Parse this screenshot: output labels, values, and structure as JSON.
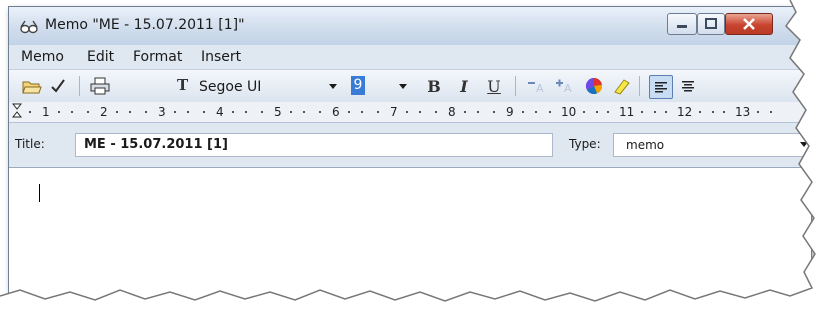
{
  "window": {
    "title": "Memo \"ME - 15.07.2011 [1]\"",
    "app_icon": "glasses-icon",
    "controls": {
      "minimize": "minimize-icon",
      "maximize": "maximize-icon",
      "close": "close-icon"
    }
  },
  "menubar": {
    "items": [
      {
        "label": "Memo"
      },
      {
        "label": "Edit"
      },
      {
        "label": "Format"
      },
      {
        "label": "Insert"
      }
    ]
  },
  "toolbar": {
    "open_icon": "open-folder-icon",
    "check_icon": "checkmark-icon",
    "print_icon": "printer-icon",
    "font_name": "Segoe UI",
    "font_size": "9",
    "bold_glyph": "B",
    "italic_glyph": "I",
    "underline_glyph": "U",
    "decrease_font_icon": "decrease-font-icon",
    "increase_font_icon": "increase-font-icon",
    "color_icon": "color-wheel-icon",
    "highlight_icon": "highlighter-icon",
    "align_left_icon": "align-left-icon",
    "align_center_icon": "align-center-icon"
  },
  "ruler": {
    "numbers": [
      "1",
      "2",
      "3",
      "4",
      "5",
      "6",
      "7",
      "8",
      "9",
      "10",
      "11",
      "12",
      "13"
    ]
  },
  "fields": {
    "title_label": "Title:",
    "title_value": "ME - 15.07.2011 [1]",
    "type_label": "Type:",
    "type_value": "memo"
  },
  "colors": {
    "chrome": "#dfe7f1",
    "titlebar": "#cfdcec",
    "close_button": "#c9452f",
    "selection": "#3a7bd5"
  }
}
